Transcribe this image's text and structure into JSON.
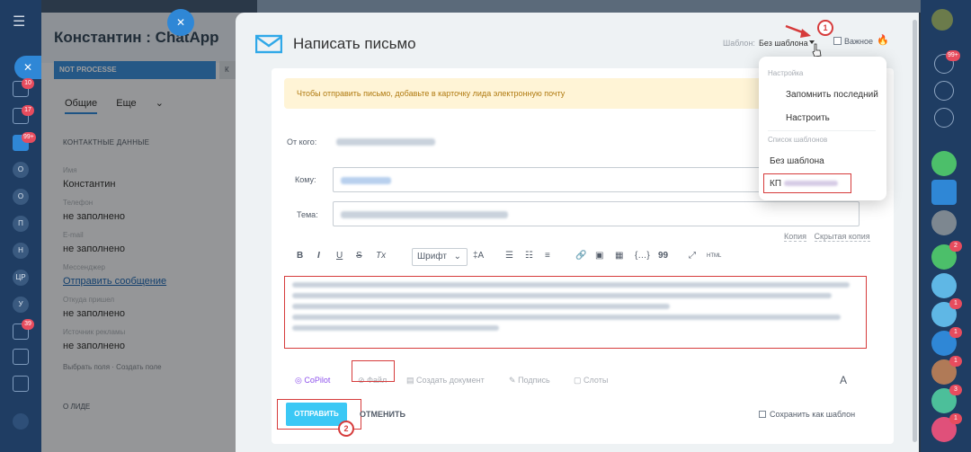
{
  "lead": {
    "title": "Константин : ChatApp",
    "stage": "NOT PROCESSE",
    "stage_next": "К",
    "tabs": [
      "Общие",
      "Еще"
    ],
    "section": "КОНТАКТНЫЕ ДАННЫЕ",
    "fields": [
      {
        "label": "Имя",
        "value": "Константин"
      },
      {
        "label": "Телефон",
        "value": "не заполнено"
      },
      {
        "label": "E-mail",
        "value": "не заполнено"
      },
      {
        "label": "Мессенджер",
        "value": "Отправить сообщение"
      },
      {
        "label": "Откуда пришел",
        "value": "не заполнено"
      },
      {
        "label": "Источник рекламы",
        "value": "не заполнено"
      }
    ],
    "footer_links": [
      "Выбрать поля",
      "Создать поле"
    ],
    "bottom_label": "О ЛИДЕ"
  },
  "leftbar_badges": [
    "10",
    "17",
    "99+",
    "39"
  ],
  "leftbar_items": [
    "О",
    "О",
    "П",
    "Н",
    "ЦР",
    "У"
  ],
  "mail": {
    "title": "Написать письмо",
    "template_label": "Шаблон:",
    "template_value": "Без шаблона",
    "important_label": "Важное",
    "warning": "Чтобы отправить письмо, добавьте в карточку лида электронную почту",
    "from_label": "От кого:",
    "to_label": "Кому:",
    "subject_label": "Тема:",
    "copy_link": "Копия",
    "hidden_copy_link": "Скрытая копия",
    "font_select": "Шрифт",
    "toolbar_labels": {
      "bold": "B",
      "italic": "I",
      "underline": "U",
      "strike": "S",
      "clear": "Tx",
      "font_size": "‡A",
      "quote": "99",
      "html": "HTML"
    },
    "actions": {
      "copilot": "CoPilot",
      "file": "Файл",
      "create_doc": "Создать документ",
      "signature": "Подпись",
      "slots": "Слоты",
      "font_a": "A"
    },
    "send_button": "ОТПРАВИТЬ",
    "cancel_button": "ОТМЕНИТЬ",
    "save_template": "Сохранить как шаблон"
  },
  "dropdown": {
    "section_settings": "Настройка",
    "remember_last": "Запомнить последний",
    "configure": "Настроить",
    "section_list": "Список шаблонов",
    "no_template": "Без шаблона",
    "kp_template": "КП"
  },
  "annotations": {
    "one": "1",
    "two": "2"
  },
  "rightbar_badges": [
    "99+",
    "1",
    "2",
    "1",
    "1",
    "1",
    "3",
    "1",
    "1"
  ],
  "colors": {
    "accent": "#2f87d6",
    "send": "#3bc8f5",
    "highlight": "#d63b3b",
    "warning_bg": "#fff4d6"
  }
}
